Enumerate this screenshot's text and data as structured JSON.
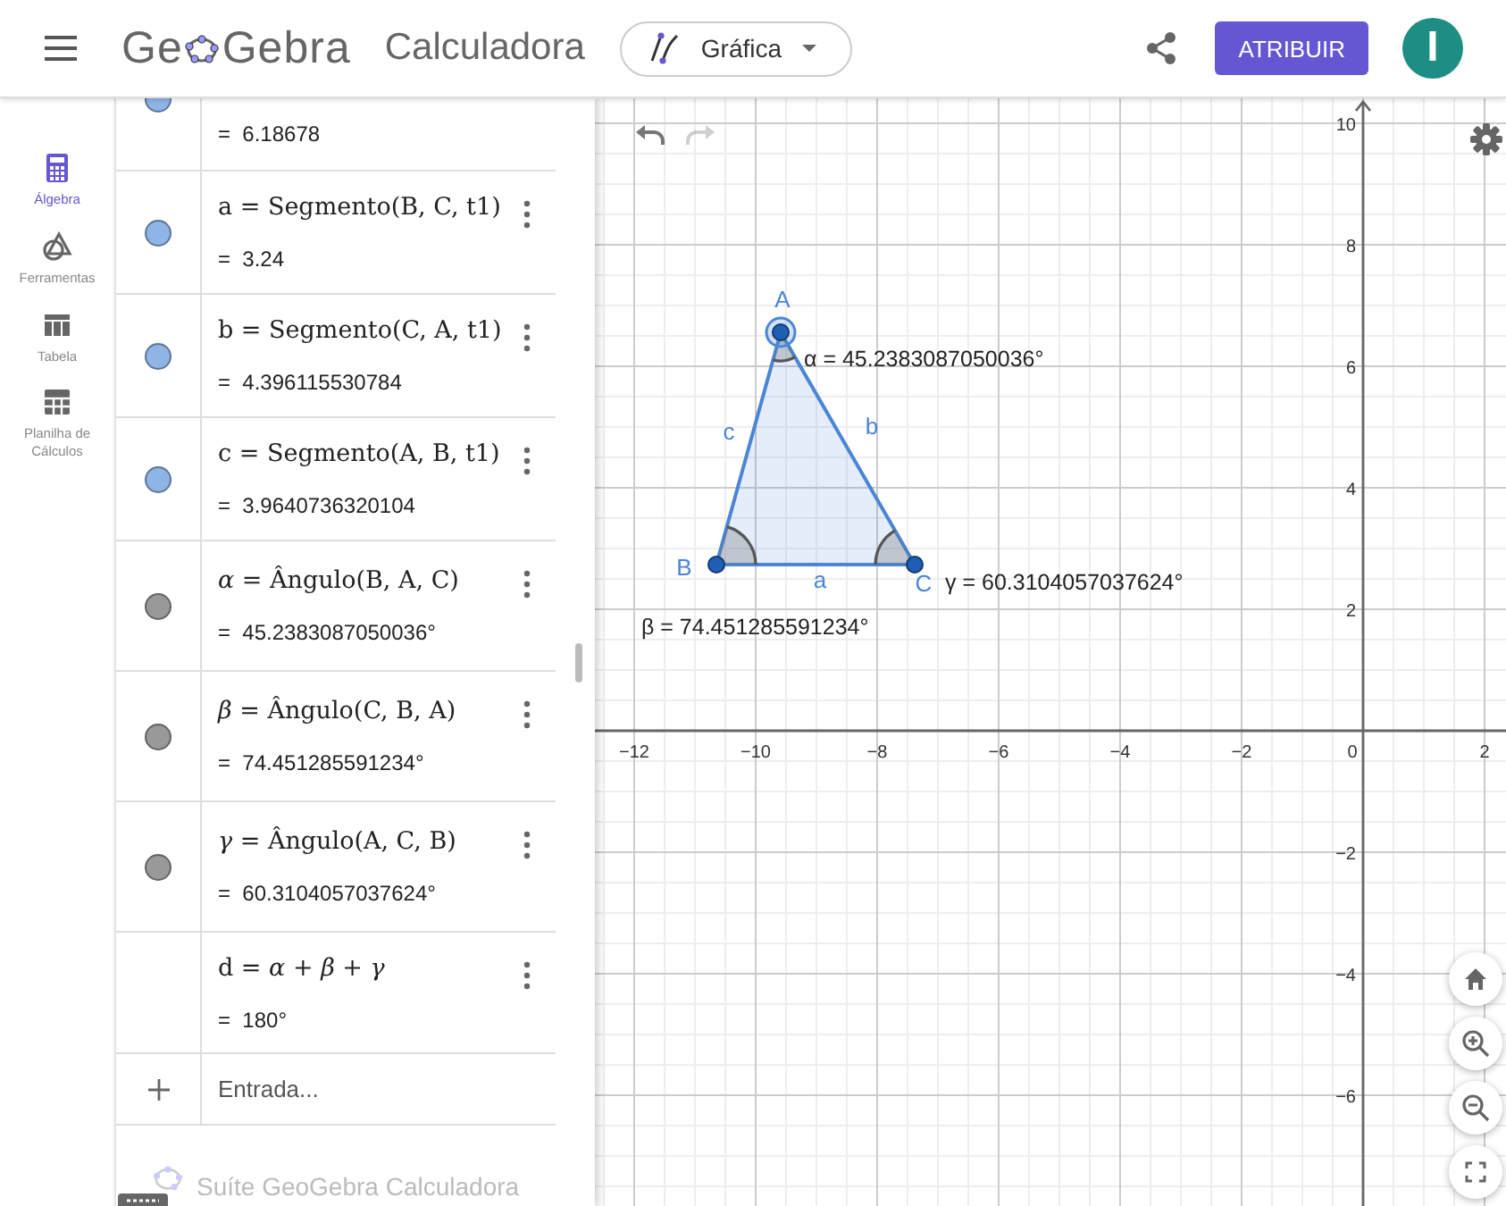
{
  "header": {
    "logo": {
      "before_icon": "Ge",
      "after_icon": "Gebra"
    },
    "title": "Calculadora",
    "view_dropdown": "Gráfica",
    "primary_button": "ATRIBUIR",
    "avatar_initial": "I"
  },
  "sidebar": {
    "items": [
      {
        "label": "Álgebra",
        "kind": "calculator",
        "selected": true
      },
      {
        "label": "Ferramentas",
        "kind": "tools",
        "selected": false
      },
      {
        "label": "Tabela",
        "kind": "table",
        "selected": false
      },
      {
        "label": "Planilha de Cálculos",
        "kind": "spreadsheet",
        "selected": false
      }
    ]
  },
  "algebra": {
    "items": [
      {
        "value": "=  6.18678",
        "color": "#8fb4e6"
      },
      {
        "definition": "a = Segmento(B, C, t1)",
        "value": "=  3.24",
        "color": "#8fb4e6"
      },
      {
        "definition": "b = Segmento(C, A, t1)",
        "value": "=  4.396115530784",
        "color": "#8fb4e6"
      },
      {
        "definition": "c = Segmento(A, B, t1)",
        "value": "=  3.9640736320104",
        "color": "#8fb4e6"
      },
      {
        "definition": "*α* = Ângulo(B, A, C)",
        "value": "=  45.2383087050036°",
        "color": "#999999"
      },
      {
        "definition": "*β* = Ângulo(C, B, A)",
        "value": "=  74.451285591234°",
        "color": "#999999"
      },
      {
        "definition": "*γ* = Ângulo(A, C, B)",
        "value": "=  60.3104057037624°",
        "color": "#999999"
      },
      {
        "definition": "d = *α* + *β* + *γ*",
        "value": "=  180°"
      }
    ],
    "input": {
      "placeholder": "Entrada..."
    },
    "footer": "Suíte GeoGebra Calculadora"
  },
  "graphics": {
    "x_ticks": [
      "−12",
      "−10",
      "−8",
      "−6",
      "−4",
      "−2",
      "0",
      "2"
    ],
    "y_ticks": [
      "10",
      "8",
      "6",
      "4",
      "2",
      "−2",
      "−4",
      "−6"
    ],
    "points": [
      {
        "label": "A",
        "selected": true
      },
      {
        "label": "B",
        "selected": false
      },
      {
        "label": "C",
        "selected": false
      }
    ],
    "segments": [
      "a",
      "b",
      "c"
    ],
    "angle_labels": [
      "α = 45.2383087050036°",
      "β = 74.451285591234°",
      "γ = 60.3104057037624°"
    ],
    "redo_disabled": true
  }
}
